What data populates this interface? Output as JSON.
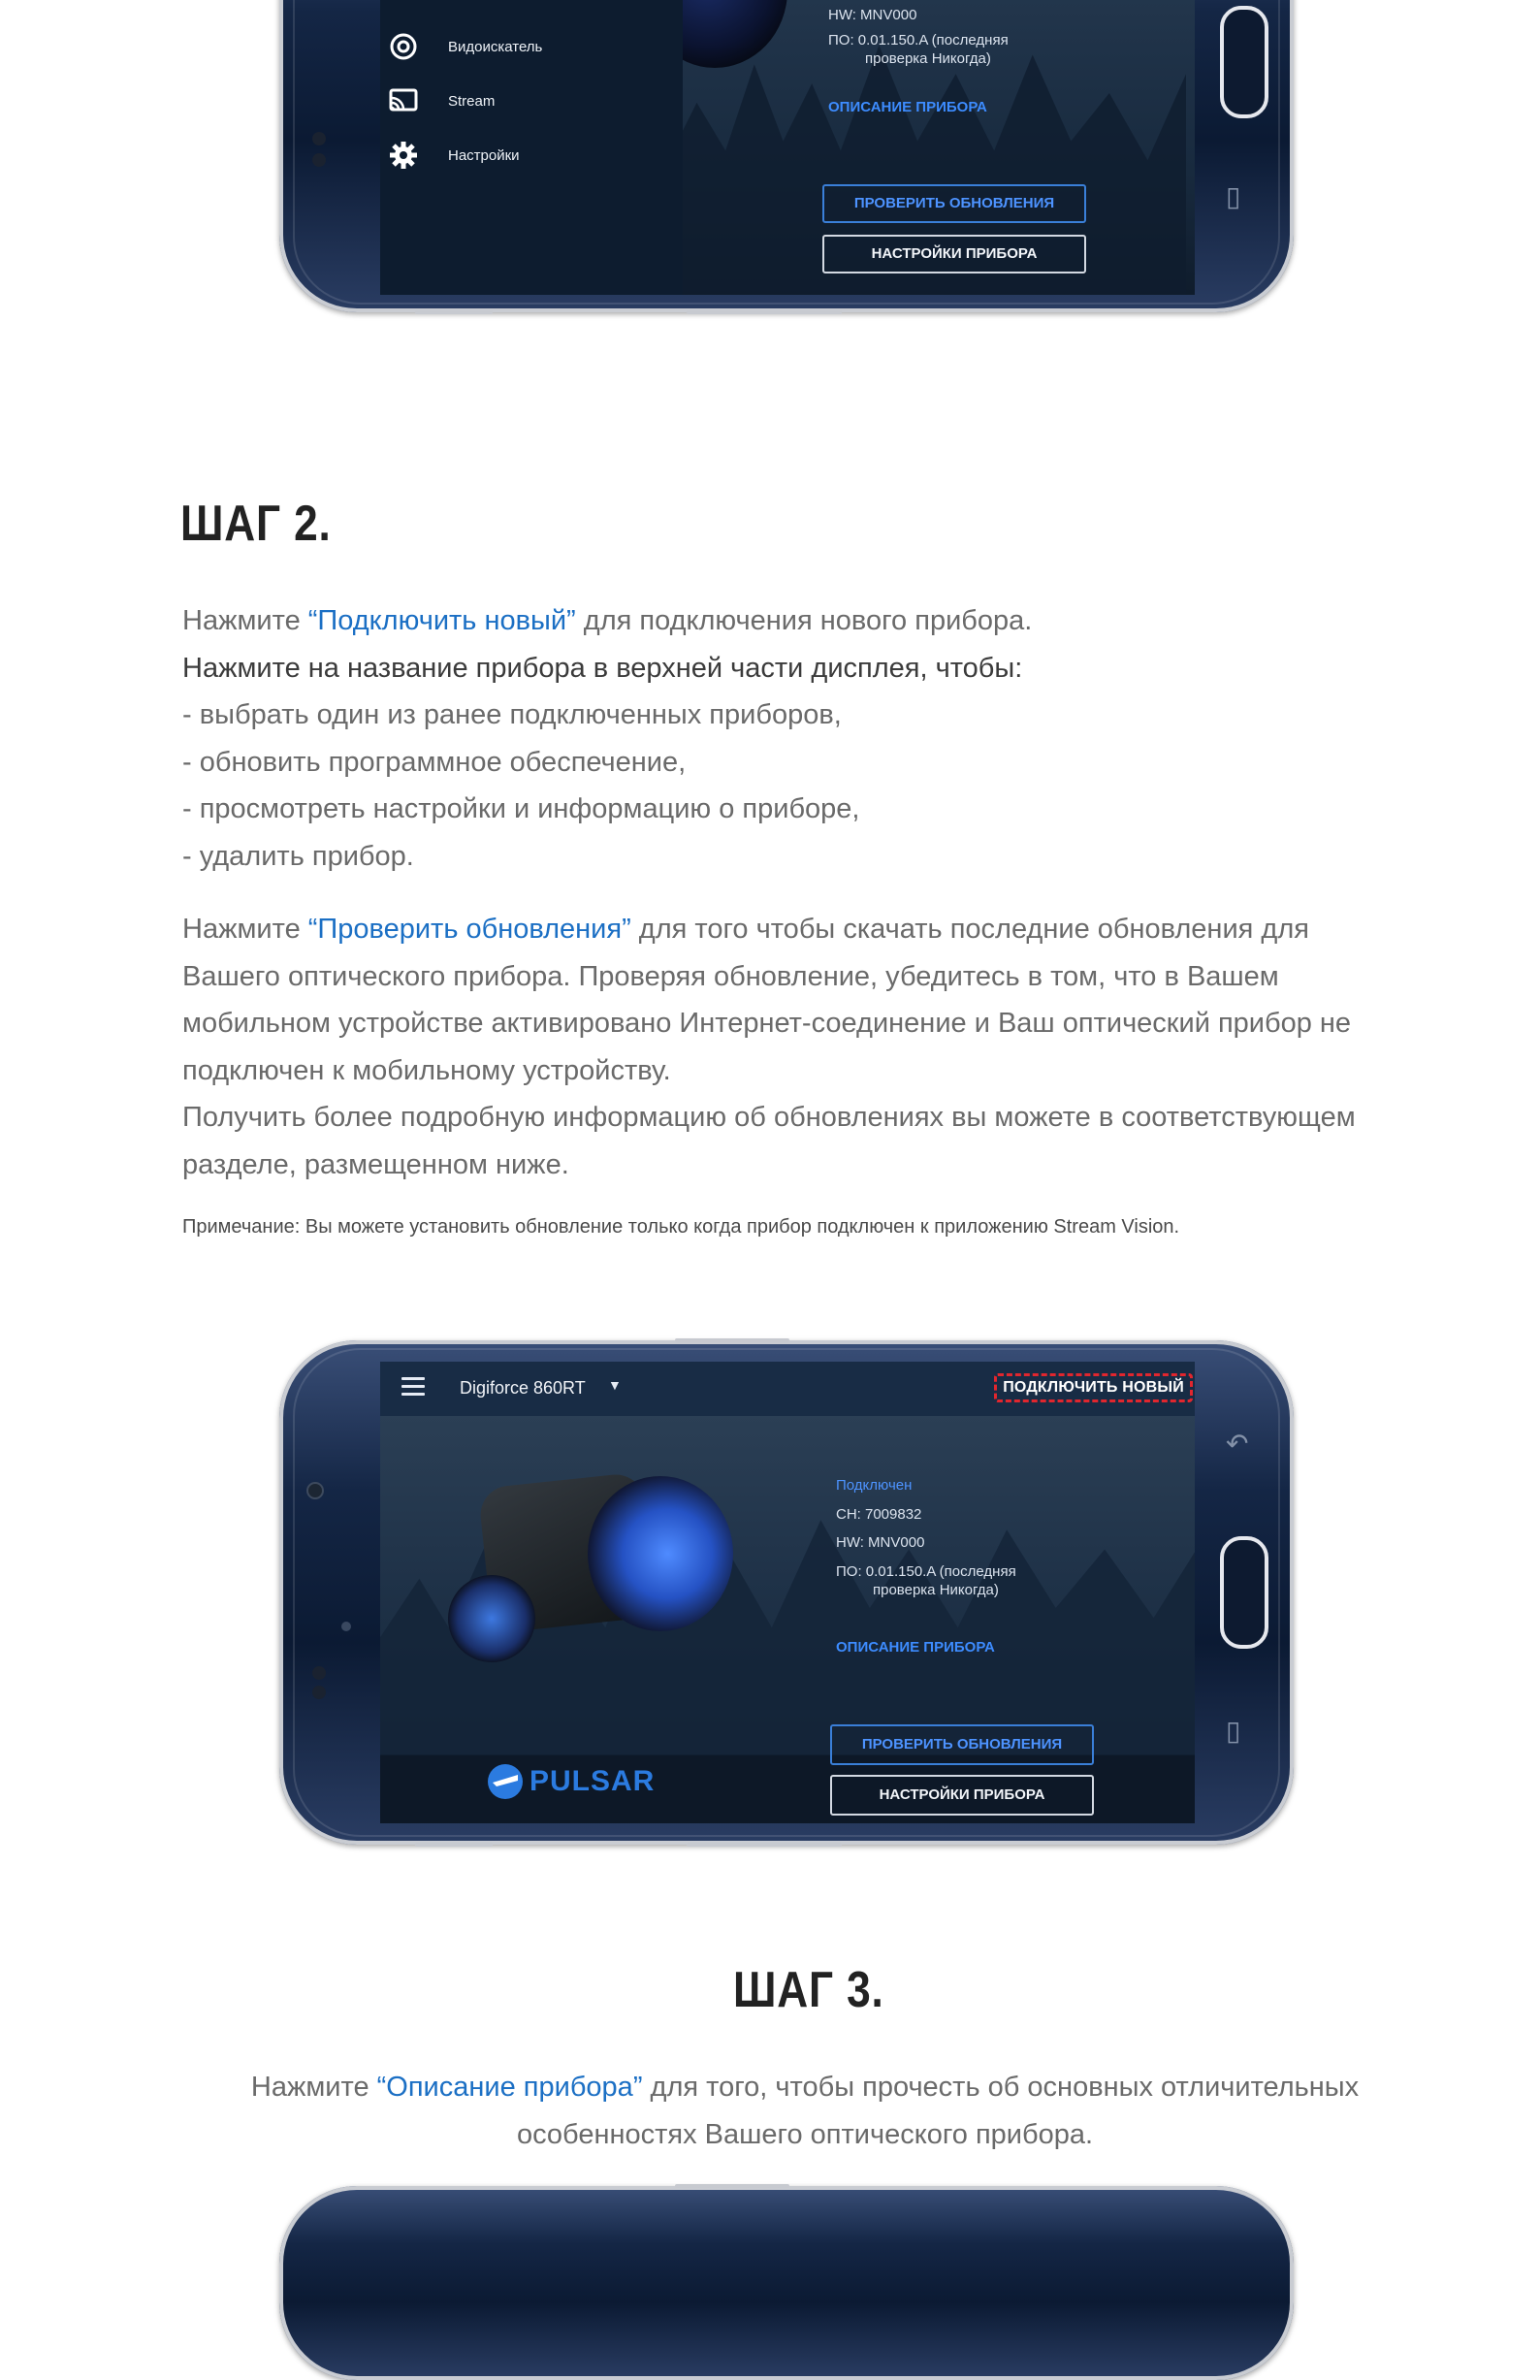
{
  "top_phone": {
    "drawer_items": [
      {
        "icon": "viewfinder-icon",
        "label": "Видоискатель"
      },
      {
        "icon": "stream-cast-icon",
        "label": "Stream"
      },
      {
        "icon": "gear-icon",
        "label": "Настройки"
      }
    ],
    "hw": "HW:  MNV000",
    "fw_line1": "ПО:  0.01.150.A (последняя",
    "fw_line2": "проверка Никогда)",
    "device_description_link": "ОПИСАНИЕ ПРИБОРА",
    "check_updates_button": "ПРОВЕРИТЬ ОБНОВЛЕНИЯ",
    "device_settings_button": "НАСТРОЙКИ ПРИБОРА"
  },
  "step2": {
    "title": "ШАГ 2.",
    "line1_prefix": "Нажмите ",
    "line1_link": "“Подключить новый”",
    "line1_suffix": " для подключения нового прибора.",
    "line2": "Нажмите на название прибора в верхней части дисплея, чтобы:",
    "bullets": [
      "- выбрать один из ранее подключенных приборов,",
      "- обновить программное обеспечение,",
      "- просмотреть настройки и информацию о приборе,",
      "- удалить прибор."
    ],
    "p2_prefix": "Нажмите ",
    "p2_link": "“Проверить обновления”",
    "p2_text": " для того чтобы скачать последние обновления для Вашего оптического прибора. Проверяя обновление, убедитесь в том, что в Вашем мобильном устройстве активировано Интернет-соединение и Ваш оптический прибор не подключен к мобильному устройству.",
    "p3": "Получить более подробную информацию об обновлениях вы можете в соответствующем разделе, размещенном ниже.",
    "note": "Примечание: Вы можете установить обновление только когда прибор подключен к приложению Stream Vision."
  },
  "middle_phone": {
    "device_name": "Digiforce 860RT",
    "connect_new": "ПОДКЛЮЧИТЬ НОВЫЙ",
    "status": "Подключен",
    "serial": "СН:  7009832",
    "hw": "HW:  MNV000",
    "fw_line1": "ПО:  0.01.150.A (последняя",
    "fw_line2": "проверка Никогда)",
    "device_description_link": "ОПИСАНИЕ ПРИБОРА",
    "check_updates_button": "ПРОВЕРИТЬ ОБНОВЛЕНИЯ",
    "device_settings_button": "НАСТРОЙКИ ПРИБОРА",
    "brand": "PULSAR"
  },
  "step3": {
    "title": "ШАГ 3.",
    "prefix": "Нажмите ",
    "link": "“Описание прибора”",
    "suffix": " для того, чтобы прочесть об основных отличительных",
    "line2": "особенностях Вашего оптического прибора."
  },
  "colors": {
    "link": "#1b6fc4",
    "highlight": "#e1262e",
    "app_blue": "#4d93ff"
  }
}
